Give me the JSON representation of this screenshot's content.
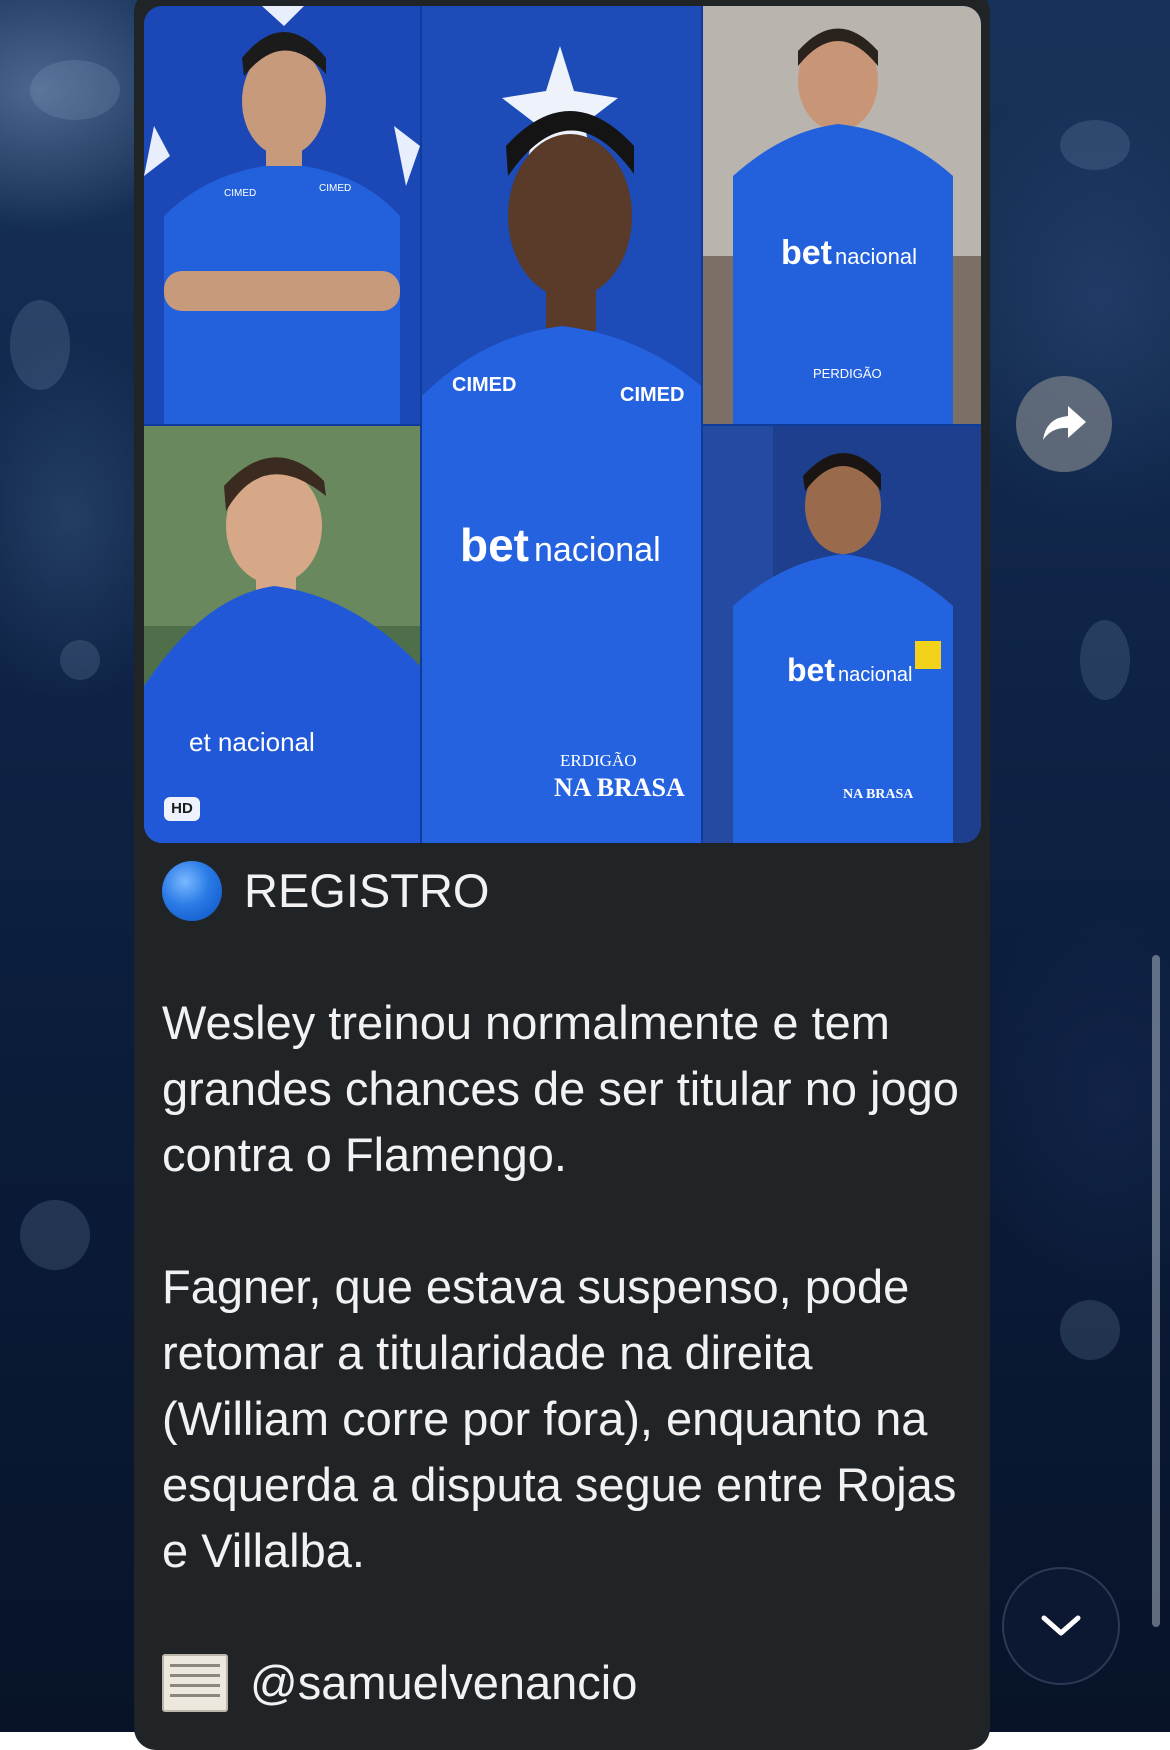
{
  "media": {
    "quality_badge": "HD",
    "description_players": 5
  },
  "message": {
    "title_emoji": "blue-circle",
    "title": "REGISTRO",
    "paragraph1": "Wesley treinou normalmente e tem grandes chances de ser titular no jogo contra o Flamengo.",
    "paragraph2": "Fagner, que estava suspenso, pode retomar a titularidade na direita (William corre por fora), enquanto na esquerda a disputa segue entre Rojas e Villalba.",
    "source_emoji": "newspaper",
    "source": "@samuelvenancio"
  },
  "controls": {
    "share_icon": "share-arrow-icon",
    "scroll_icon": "chevron-down-icon"
  },
  "colors": {
    "bubble": "#212426",
    "text": "#f2f2f2",
    "jersey_blue": "#1f55d6"
  }
}
